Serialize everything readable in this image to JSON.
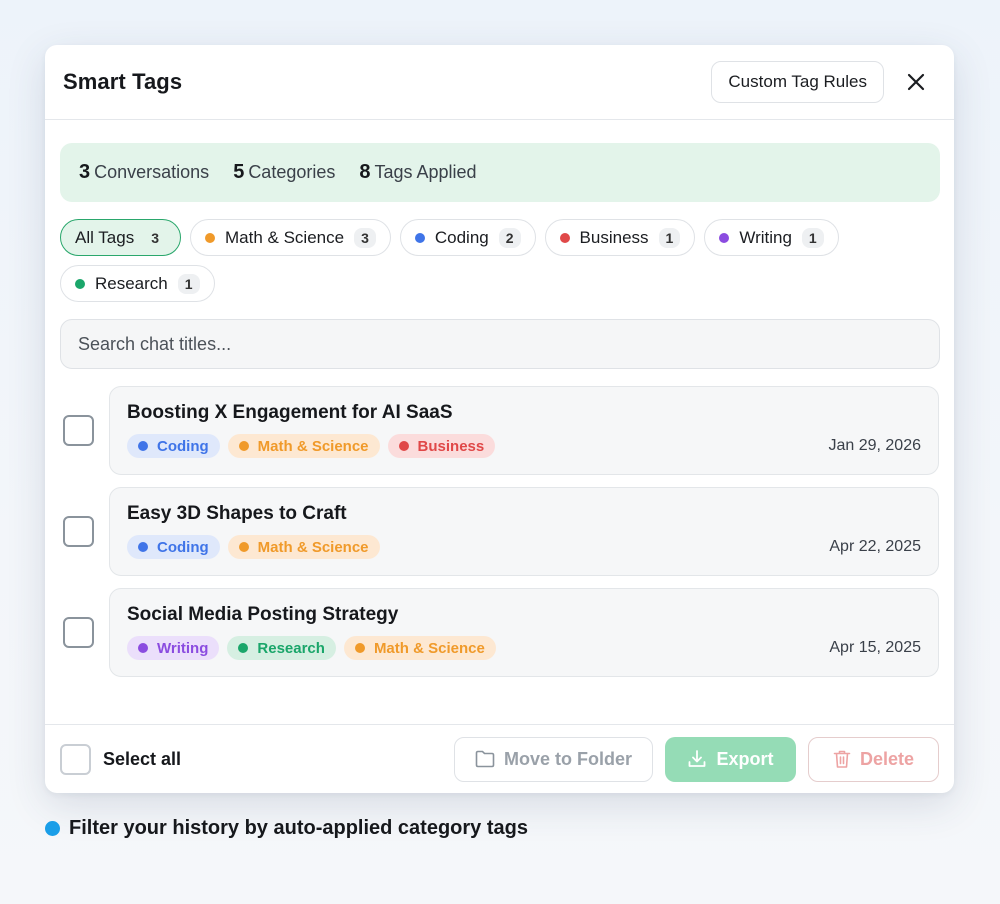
{
  "header": {
    "title": "Smart Tags",
    "rules_label": "Custom Tag Rules"
  },
  "stats": [
    {
      "value": "3",
      "label": "Conversations"
    },
    {
      "value": "5",
      "label": "Categories"
    },
    {
      "value": "8",
      "label": "Tags Applied"
    }
  ],
  "filters": [
    {
      "label": "All Tags",
      "count": "3",
      "color": "",
      "active": true
    },
    {
      "label": "Math & Science",
      "count": "3",
      "color": "#f09a2a"
    },
    {
      "label": "Coding",
      "count": "2",
      "color": "#3f74e8"
    },
    {
      "label": "Business",
      "count": "1",
      "color": "#e04848"
    },
    {
      "label": "Writing",
      "count": "1",
      "color": "#8b4ce0"
    },
    {
      "label": "Research",
      "count": "1",
      "color": "#1aa66a"
    }
  ],
  "search": {
    "placeholder": "Search chat titles..."
  },
  "tag_styles": {
    "Coding": {
      "bg": "#dfe8fb",
      "fg": "#3f74e8"
    },
    "Math & Science": {
      "bg": "#fde8d2",
      "fg": "#f09a2a"
    },
    "Business": {
      "bg": "#fbdcdc",
      "fg": "#e04848"
    },
    "Writing": {
      "bg": "#ebdffb",
      "fg": "#8b4ce0"
    },
    "Research": {
      "bg": "#d6efe2",
      "fg": "#1aa66a"
    }
  },
  "conversations": [
    {
      "title": "Boosting X Engagement for AI SaaS",
      "tags": [
        "Coding",
        "Math & Science",
        "Business"
      ],
      "date": "Jan 29, 2026"
    },
    {
      "title": "Easy 3D Shapes to Craft",
      "tags": [
        "Coding",
        "Math & Science"
      ],
      "date": "Apr 22, 2025"
    },
    {
      "title": "Social Media Posting Strategy",
      "tags": [
        "Writing",
        "Research",
        "Math & Science"
      ],
      "date": "Apr 15, 2025"
    }
  ],
  "footer": {
    "select_all": "Select all",
    "move_label": "Move to Folder",
    "export_label": "Export",
    "delete_label": "Delete"
  },
  "caption": "Filter your history by auto-applied category tags"
}
